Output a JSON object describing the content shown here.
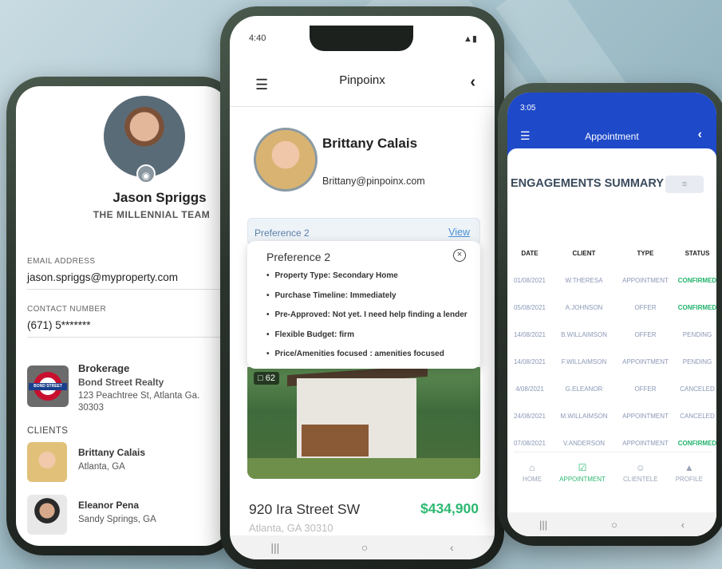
{
  "left_phone": {
    "profile_name": "Jason Spriggs",
    "team": "THE MILLENNIAL TEAM",
    "email_label": "EMAIL ADDRESS",
    "email": "jason.spriggs@myproperty.com",
    "contact_label": "CONTACT NUMBER",
    "contact": "(671) 5*******",
    "brokerage_label": "Brokerage",
    "brokerage_name": "Bond Street Realty",
    "brokerage_address": "123 Peachtree St, Atlanta Ga. 30303",
    "brokerage_logo_text": "BOND STREET",
    "clients_label": "CLIENTS",
    "clients": [
      {
        "name": "Brittany Calais",
        "location": "Atlanta, GA"
      },
      {
        "name": "Eleanor Pena",
        "location": "Sandy Springs, GA"
      }
    ]
  },
  "center_phone": {
    "status_time": "4:40",
    "header_title": "Pinpoinx",
    "user_name": "Brittany Calais",
    "user_email": "Brittany@pinpoinx.com",
    "pref_bar_label": "Preference 2",
    "pref_bar_link": "View",
    "popup": {
      "title": "Preference 2",
      "items": [
        "Property Type: Secondary Home",
        "Purchase Timeline: Immediately",
        "Pre-Approved: Not yet. I need help finding a lender",
        "Flexible Budget: firm",
        "Price/Amenities focused : amenities focused"
      ]
    },
    "photo_count": "62",
    "address": "920 Ira Street SW",
    "price": "$434,900",
    "city": "Atlanta, GA 30310"
  },
  "right_phone": {
    "status_time": "3:05",
    "header_title": "Appointment",
    "summary_title": "ENGAGEMENTS SUMMARY",
    "columns": [
      "DATE",
      "CLIENT",
      "TYPE",
      "STATUS"
    ],
    "rows": [
      {
        "date": "01/08/2021",
        "client": "W.THERESA",
        "type": "APPOINTMENT",
        "status": "CONFIRMED",
        "kind": "confirmed"
      },
      {
        "date": "05/08/2021",
        "client": "A.JOHNSON",
        "type": "OFFER",
        "status": "CONFIRMED",
        "kind": "confirmed"
      },
      {
        "date": "14/08/2021",
        "client": "B.WILLAIMSON",
        "type": "OFFER",
        "status": "PENDING",
        "kind": "pending"
      },
      {
        "date": "14/08/2021",
        "client": "F.WILLAIMSON",
        "type": "APPOINTMENT",
        "status": "PENDING",
        "kind": "pending"
      },
      {
        "date": "4/08/2021",
        "client": "G.ELEANOR",
        "type": "OFFER",
        "status": "CANCELED",
        "kind": "canceled"
      },
      {
        "date": "24/08/2021",
        "client": "M.WILLAIMSON",
        "type": "APPOINTMENT",
        "status": "CANCELED",
        "kind": "canceled"
      },
      {
        "date": "07/08/2021",
        "client": "V.ANDERSON",
        "type": "APPOINTMENT",
        "status": "CONFIRMED",
        "kind": "confirmed"
      }
    ],
    "tabs": [
      {
        "label": "HOME",
        "icon": "home-icon",
        "active": false
      },
      {
        "label": "APPOINTMENT",
        "icon": "calendar-check-icon",
        "active": true
      },
      {
        "label": "CLIENTELE",
        "icon": "people-icon",
        "active": false
      },
      {
        "label": "PROFILE",
        "icon": "person-icon",
        "active": false
      }
    ]
  }
}
